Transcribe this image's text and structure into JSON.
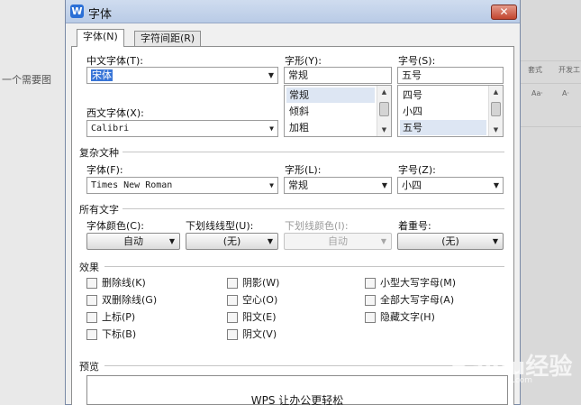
{
  "background": {
    "left_text": "一个需要图",
    "right_texts": [
      "套式",
      "开发工",
      "Aa·",
      "A·"
    ]
  },
  "dialog": {
    "app_icon": "W",
    "title": "字体",
    "close": "✕"
  },
  "tabs": [
    {
      "label": "字体(N)",
      "active": true
    },
    {
      "label": "字符间距(R)",
      "active": false
    }
  ],
  "chinese_font": {
    "label": "中文字体(T):",
    "value": "宋体"
  },
  "western_font": {
    "label": "西文字体(X):",
    "value": "Calibri"
  },
  "style": {
    "label": "字形(Y):",
    "value": "常规",
    "options": [
      "常规",
      "倾斜",
      "加粗"
    ],
    "selected": "常规"
  },
  "size": {
    "label": "字号(S):",
    "value": "五号",
    "options": [
      "四号",
      "小四",
      "五号"
    ],
    "selected": "五号"
  },
  "complex": {
    "header": "复杂文种",
    "font_label": "字体(F):",
    "font_value": "Times New Roman",
    "style_label": "字形(L):",
    "style_value": "常规",
    "size_label": "字号(Z):",
    "size_value": "小四"
  },
  "all_text": {
    "header": "所有文字",
    "color_label": "字体颜色(C):",
    "color_value": "自动",
    "underline_label": "下划线线型(U):",
    "underline_value": "(无)",
    "underline_color_label": "下划线颜色(I):",
    "underline_color_value": "自动",
    "emphasis_label": "着重号:",
    "emphasis_value": "(无)"
  },
  "effects": {
    "header": "效果",
    "col1": [
      "删除线(K)",
      "双删除线(G)",
      "上标(P)",
      "下标(B)"
    ],
    "col2": [
      "阴影(W)",
      "空心(O)",
      "阳文(E)",
      "阴文(V)"
    ],
    "col3": [
      "小型大写字母(M)",
      "全部大写字母(A)",
      "隐藏文字(H)"
    ]
  },
  "preview": {
    "header": "预览",
    "text": "WPS 让办公更轻松"
  },
  "watermark": {
    "text": "Baidu经验",
    "url": "jingyan.baidu.com"
  },
  "icons": [
    "app-icon",
    "close-icon",
    "dropdown-arrow-icon",
    "scroll-up-icon",
    "scroll-down-icon"
  ]
}
